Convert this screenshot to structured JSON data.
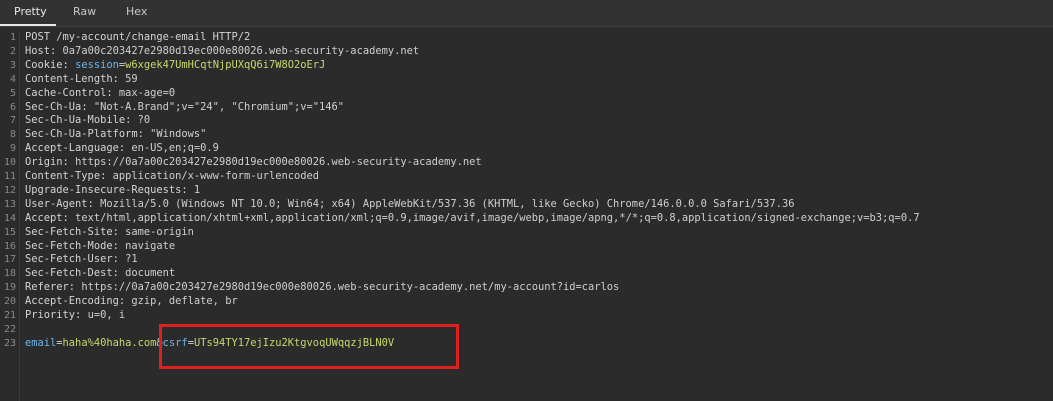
{
  "tabs": [
    {
      "label": "Pretty",
      "active": true
    },
    {
      "label": "Raw",
      "active": false
    },
    {
      "label": "Hex",
      "active": false
    }
  ],
  "colors": {
    "background": "#2b2b2b",
    "param_name": "#6cb6e8",
    "param_value": "#c5d96a",
    "highlight_box": "#e0201e"
  },
  "request": {
    "line_numbers": [
      "1",
      "2",
      "3",
      "4",
      "5",
      "6",
      "7",
      "8",
      "9",
      "10",
      "11",
      "12",
      "13",
      "14",
      "15",
      "16",
      "17",
      "18",
      "19",
      "20",
      "21",
      "22",
      "23"
    ],
    "request_line": "POST /my-account/change-email HTTP/2",
    "headers": [
      {
        "name": "Host",
        "value": "0a7a00c203427e2980d19ec000e80026.web-security-academy.net"
      },
      {
        "name": "Cookie",
        "value": null
      },
      {
        "name": "Content-Length",
        "value": "59"
      },
      {
        "name": "Cache-Control",
        "value": "max-age=0"
      },
      {
        "name": "Sec-Ch-Ua",
        "value": "\"Not-A.Brand\";v=\"24\", \"Chromium\";v=\"146\""
      },
      {
        "name": "Sec-Ch-Ua-Mobile",
        "value": "?0"
      },
      {
        "name": "Sec-Ch-Ua-Platform",
        "value": "\"Windows\""
      },
      {
        "name": "Accept-Language",
        "value": "en-US,en;q=0.9"
      },
      {
        "name": "Origin",
        "value": "https://0a7a00c203427e2980d19ec000e80026.web-security-academy.net"
      },
      {
        "name": "Content-Type",
        "value": "application/x-www-form-urlencoded"
      },
      {
        "name": "Upgrade-Insecure-Requests",
        "value": "1"
      },
      {
        "name": "User-Agent",
        "value": "Mozilla/5.0 (Windows NT 10.0; Win64; x64) AppleWebKit/537.36 (KHTML, like Gecko) Chrome/146.0.0.0 Safari/537.36"
      },
      {
        "name": "Accept",
        "value": "text/html,application/xhtml+xml,application/xml;q=0.9,image/avif,image/webp,image/apng,*/*;q=0.8,application/signed-exchange;v=b3;q=0.7"
      },
      {
        "name": "Sec-Fetch-Site",
        "value": "same-origin"
      },
      {
        "name": "Sec-Fetch-Mode",
        "value": "navigate"
      },
      {
        "name": "Sec-Fetch-User",
        "value": "?1"
      },
      {
        "name": "Sec-Fetch-Dest",
        "value": "document"
      },
      {
        "name": "Referer",
        "value": "https://0a7a00c203427e2980d19ec000e80026.web-security-academy.net/my-account?id=carlos"
      },
      {
        "name": "Accept-Encoding",
        "value": "gzip, deflate, br"
      },
      {
        "name": "Priority",
        "value": "u=0, i"
      }
    ],
    "cookie": {
      "name": "session",
      "eq": "=",
      "value": "w6xgek47UmHCqtNjpUXqQ6i7W8O2oErJ"
    },
    "sep": ": ",
    "body": {
      "email_name": "email",
      "eq": "=",
      "email_value": "haha%40haha.com",
      "amp": "&",
      "csrf_name": "csrf",
      "csrf_value": "UTs94TY17ejIzu2KtgvoqUWqqzjBLN0V"
    }
  }
}
